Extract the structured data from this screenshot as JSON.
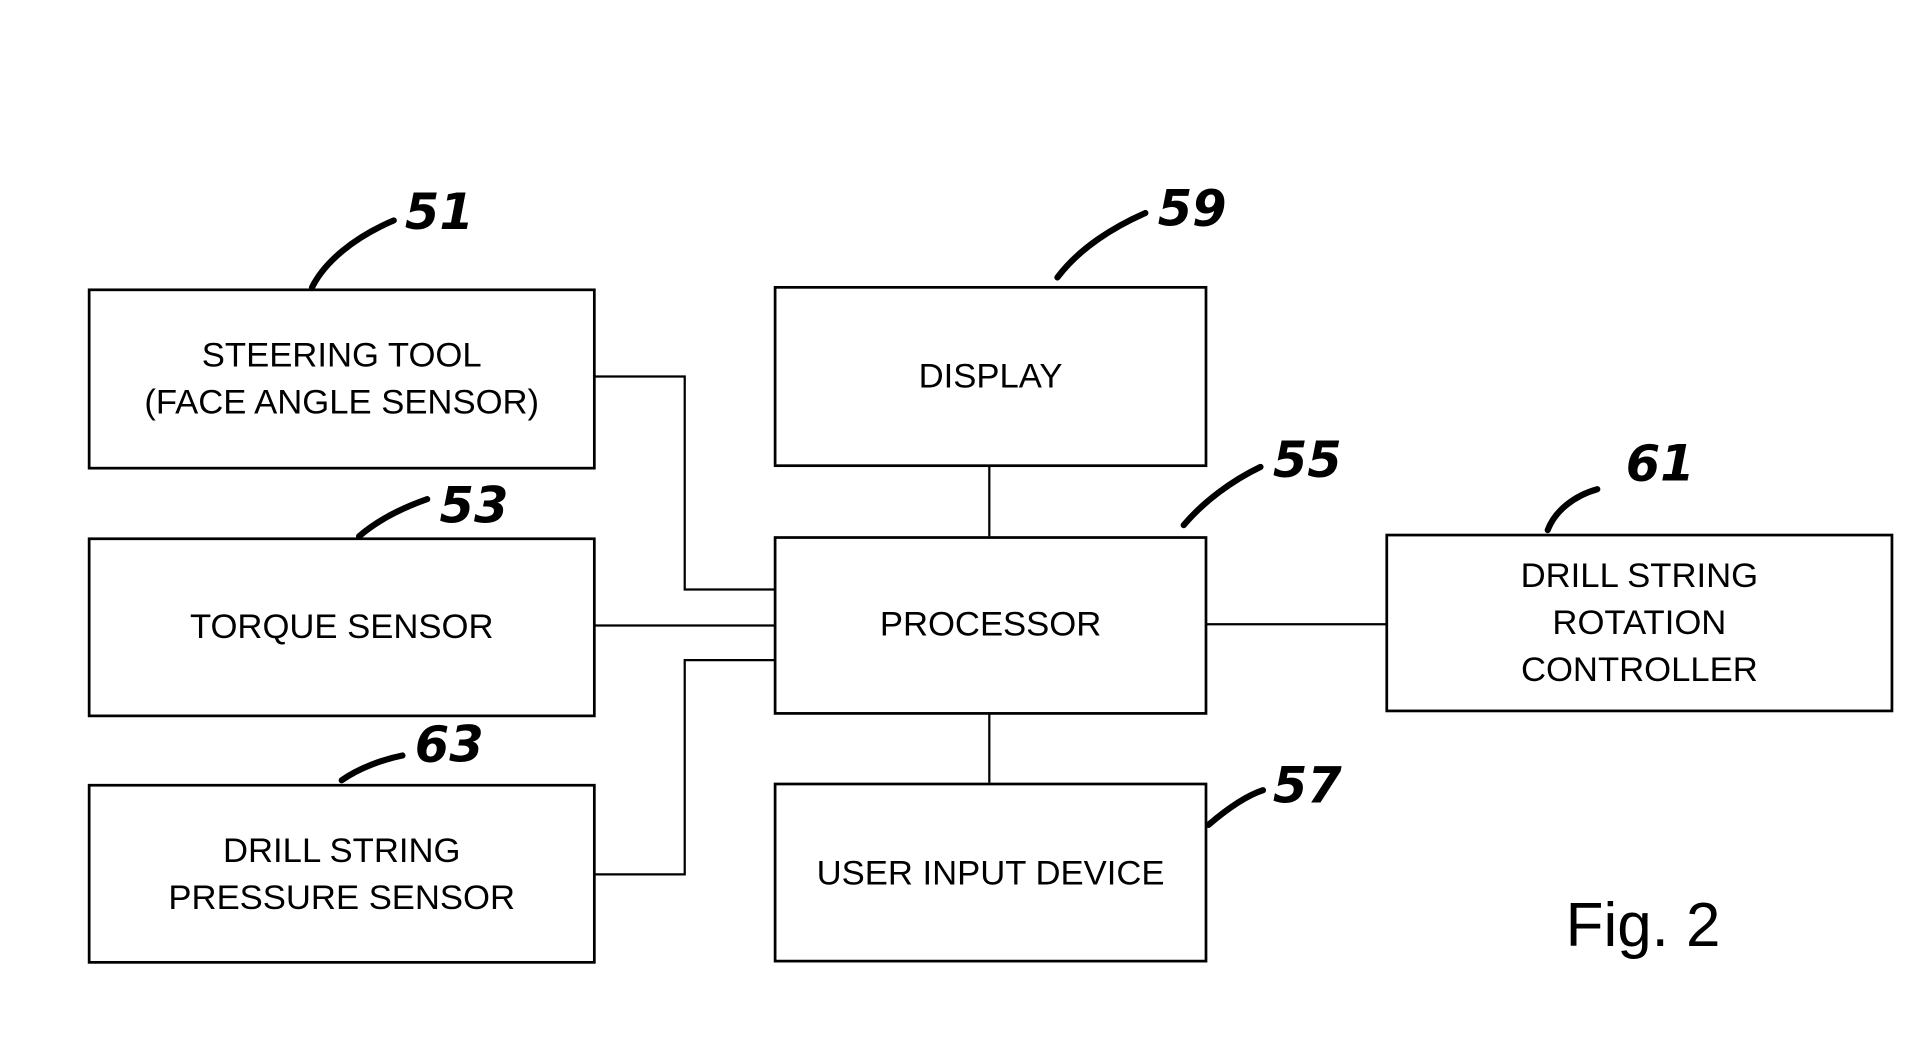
{
  "figure_label": "Fig. 2",
  "blocks": {
    "steering_tool": {
      "ref": "51",
      "lines": [
        "STEERING TOOL",
        "(FACE ANGLE SENSOR)"
      ]
    },
    "torque_sensor": {
      "ref": "53",
      "lines": [
        "TORQUE SENSOR"
      ]
    },
    "pressure_sensor": {
      "ref": "63",
      "lines": [
        "DRILL STRING",
        "PRESSURE SENSOR"
      ]
    },
    "display": {
      "ref": "59",
      "lines": [
        "DISPLAY"
      ]
    },
    "processor": {
      "ref": "55",
      "lines": [
        "PROCESSOR"
      ]
    },
    "user_input": {
      "ref": "57",
      "lines": [
        "USER INPUT DEVICE"
      ]
    },
    "rotation_controller": {
      "ref": "61",
      "lines": [
        "DRILL STRING",
        "ROTATION",
        "CONTROLLER"
      ]
    }
  },
  "connections": [
    {
      "from": "steering_tool",
      "to": "processor"
    },
    {
      "from": "torque_sensor",
      "to": "processor"
    },
    {
      "from": "pressure_sensor",
      "to": "processor"
    },
    {
      "from": "display",
      "to": "processor"
    },
    {
      "from": "user_input",
      "to": "processor"
    },
    {
      "from": "processor",
      "to": "rotation_controller"
    }
  ]
}
